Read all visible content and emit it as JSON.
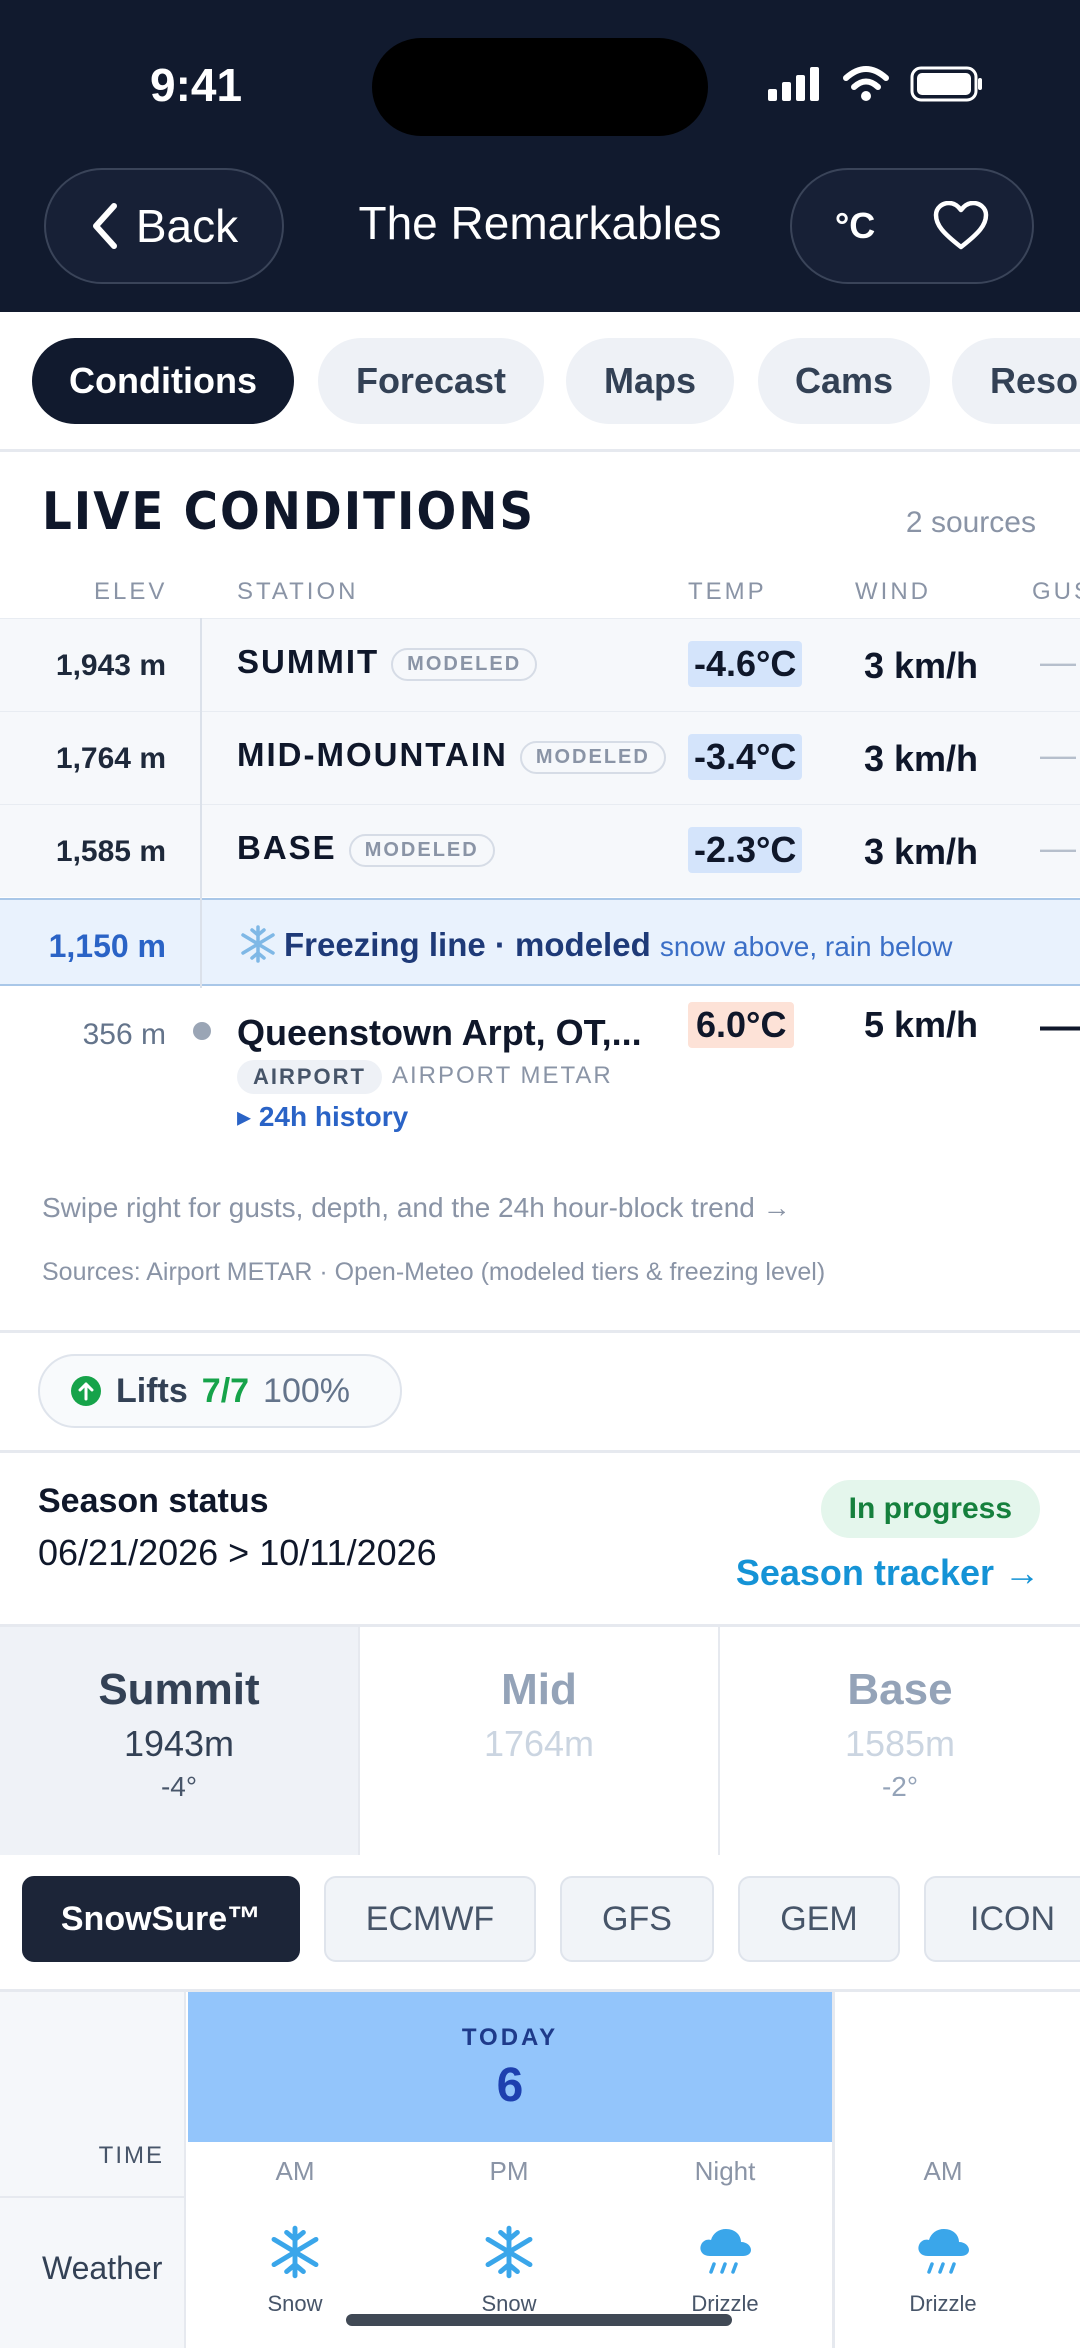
{
  "status": {
    "time": "9:41"
  },
  "header": {
    "back_label": "Back",
    "title": "The Remarkables",
    "unit_label": "°C"
  },
  "tabs": [
    "Conditions",
    "Forecast",
    "Maps",
    "Cams",
    "Resor"
  ],
  "live": {
    "title": "LIVE CONDITIONS",
    "sources_count": "2 sources",
    "columns": {
      "elev": "ELEV",
      "station": "STATION",
      "temp": "TEMP",
      "wind": "WIND",
      "gust": "GUS"
    },
    "rows": [
      {
        "elev": "1,943 m",
        "station": "SUMMIT",
        "badge": "MODELED",
        "temp": "-4.6°C",
        "wind": "3 km/h",
        "gust": "—"
      },
      {
        "elev": "1,764 m",
        "station": "MID-MOUNTAIN",
        "badge": "MODELED",
        "temp": "-3.4°C",
        "wind": "3 km/h",
        "gust": "—"
      },
      {
        "elev": "1,585 m",
        "station": "BASE",
        "badge": "MODELED",
        "temp": "-2.3°C",
        "wind": "3 km/h",
        "gust": "—"
      }
    ],
    "freezing": {
      "elev": "1,150 m",
      "label": "Freezing line · modeled",
      "sub": "snow above, rain below"
    },
    "airport": {
      "elev": "356 m",
      "name": "Queenstown Arpt, OT,...",
      "badge": "AIRPORT",
      "source": "AIRPORT METAR",
      "history": "▸ 24h history",
      "temp": "6.0°C",
      "wind": "5 km/h",
      "gust": "—"
    },
    "hint": "Swipe right for gusts, depth, and the 24h hour-block trend →",
    "sources": "Sources: Airport METAR · Open-Meteo (modeled tiers & freezing level)"
  },
  "lifts": {
    "label": "Lifts",
    "value": "7/7",
    "percent": "100%"
  },
  "season": {
    "label": "Season status",
    "dates": "06/21/2026 > 10/11/2026",
    "status": "In progress",
    "link": "Season tracker →"
  },
  "elevation_tabs": [
    {
      "name": "Summit",
      "elev": "1943m",
      "temp": "-4°"
    },
    {
      "name": "Mid",
      "elev": "1764m",
      "temp": ""
    },
    {
      "name": "Base",
      "elev": "1585m",
      "temp": "-2°"
    }
  ],
  "models": [
    "SnowSure™",
    "ECMWF",
    "GFS",
    "GEM",
    "ICON"
  ],
  "forecast": {
    "time_label": "TIME",
    "weather_label": "Weather",
    "today_label": "TODAY",
    "today_num": "6",
    "periods": [
      "AM",
      "PM",
      "Night",
      "AM"
    ],
    "weather": [
      "Snow",
      "Snow",
      "Drizzle",
      "Drizzle"
    ]
  },
  "colors": {
    "header_bg": "#111a2e",
    "accent_blue": "#2a63c6",
    "lifts_green": "#16a34a",
    "today_bg": "#93c5fb"
  }
}
